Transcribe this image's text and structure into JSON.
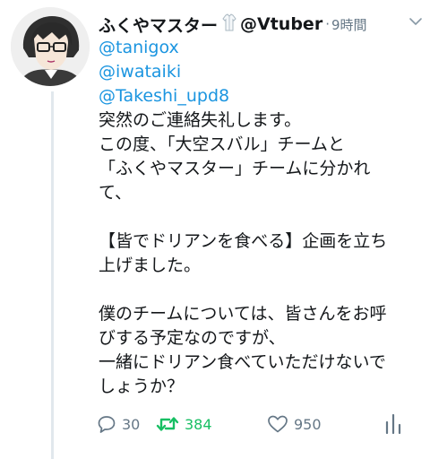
{
  "tweet": {
    "display_name": "ふくやマスター",
    "handle": "@Vtuber",
    "separator": "·",
    "timestamp": "9時間",
    "mentions": [
      "@tanigox",
      "@iwataiki",
      "@Takeshi_upd8"
    ],
    "text_lines": [
      "突然のご連絡失礼します。",
      "この度、「大空スバル」チームと",
      "「ふくやマスター」チームに分かれ",
      "て、",
      "",
      "【皆でドリアンを食べる】企画を立ち",
      "上げました。",
      "",
      "僕のチームについては、皆さんをお呼",
      "びする予定なのですが、",
      "一緒にドリアン食べていただけないで",
      "しょうか？"
    ]
  },
  "actions": {
    "reply_count": "30",
    "retweet_count": "384",
    "like_count": "950"
  },
  "colors": {
    "text": "#14171a",
    "secondary": "#657786",
    "link": "#1b95e0",
    "retweeted": "#17bf63",
    "thread_line": "#e1e8ed"
  },
  "icons": {
    "name_emoji": "shirt-icon",
    "menu": "chevron-down-icon",
    "reply": "reply-icon",
    "retweet": "retweet-icon",
    "like": "heart-icon",
    "analytics": "analytics-icon"
  }
}
